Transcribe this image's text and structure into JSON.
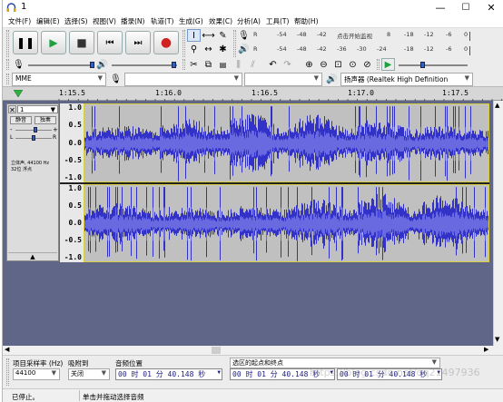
{
  "window": {
    "title": "1",
    "minimize": "—",
    "maximize": "☐",
    "close": "✕"
  },
  "menu": [
    "文件(F)",
    "编辑(E)",
    "选择(S)",
    "视图(V)",
    "播录(N)",
    "轨道(T)",
    "生成(G)",
    "效果(C)",
    "分析(A)",
    "工具(T)",
    "帮助(H)"
  ],
  "transport": {
    "pause": "❚❚",
    "play": "▶",
    "stop": "■",
    "skip_start": "⏮",
    "skip_end": "⏭",
    "record": "●"
  },
  "meters": {
    "record_row": [
      "-54",
      "-48",
      "-42",
      "点击开始监视",
      "8",
      "-18",
      "-12",
      "-6",
      "0"
    ],
    "play_row": [
      "-54",
      "-48",
      "-42",
      "-36",
      "-30",
      "-24",
      "-18",
      "-12",
      "-6",
      "0"
    ]
  },
  "edit_tools": {
    "cut": "✂",
    "copy": "⧉",
    "paste": "📋",
    "undo": "↶",
    "redo": "↷"
  },
  "zoom_tools": [
    "⊕",
    "⊖",
    "⊡",
    "⊙",
    "⊘"
  ],
  "device": {
    "host": "MME",
    "playback_device": "扬声器 (Realtek High Definition"
  },
  "ruler": {
    "ticks": [
      "1:15.5",
      "1:16.0",
      "1:16.5",
      "1:17.0",
      "1:17.5"
    ]
  },
  "track": {
    "name": "1",
    "mute": "静音",
    "solo": "独奏",
    "gain_minus": "-",
    "gain_plus": "+",
    "pan_left": "L",
    "pan_right": "R",
    "info_line1": "立体声, 44100 Hz",
    "info_line2": "32位 浮点",
    "collapse": "▲",
    "channel_scale": [
      "1.0",
      "0.5",
      "0.0",
      "-0.5",
      "-1.0"
    ]
  },
  "selection_bar": {
    "rate_label": "项目采样率 (Hz)",
    "rate_value": "44100",
    "snap_label": "吸附到",
    "snap_value": "关闭",
    "audio_pos_label": "音频位置",
    "audio_pos_value": "00 时 01 分 40.148 秒",
    "sel_label": "选区的起点和终点",
    "sel_start": "00 时 01 分 40.148 秒",
    "sel_end": "00 时 01 分 40.148 秒"
  },
  "status": {
    "state": "已停止。",
    "hint": "单击并拖动选择音频"
  },
  "watermark": "https://blog.csdn.net/qq21497936",
  "colors": {
    "wave": "#3232c8",
    "wave_light": "#6a6ae0",
    "track_bg": "#5f6688",
    "record": "#d02020",
    "play": "#20a040"
  }
}
